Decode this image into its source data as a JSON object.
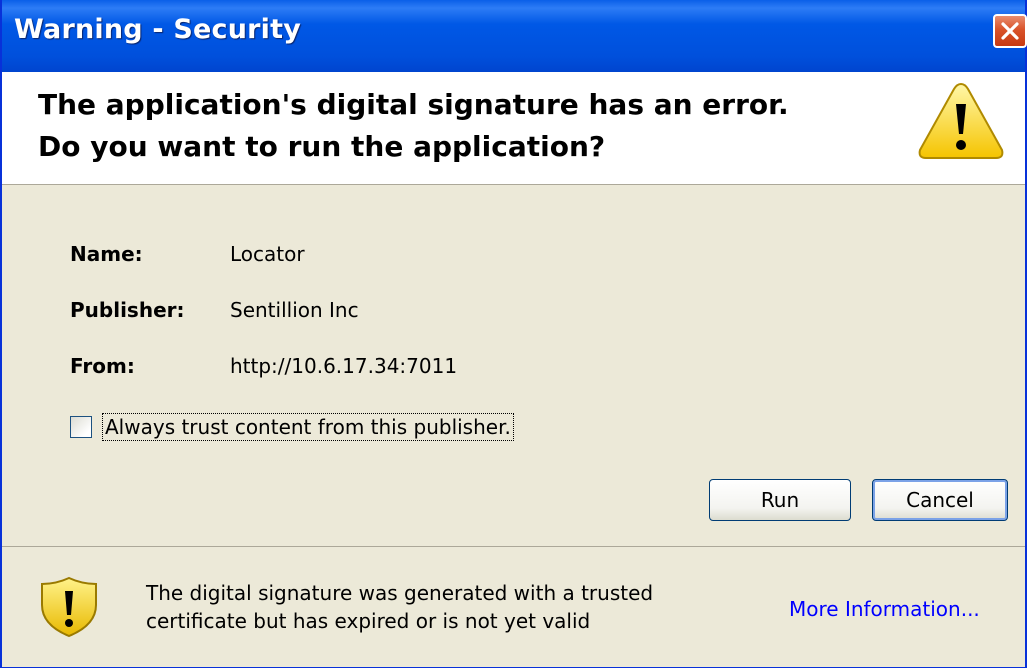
{
  "window": {
    "title": "Warning - Security",
    "close_icon": "close-icon"
  },
  "header": {
    "line1": "The application's digital signature has an error.",
    "line2": "Do you want to run the application?",
    "icon": "warning-triangle-icon"
  },
  "details": {
    "name_label": "Name:",
    "name_value": "Locator",
    "publisher_label": "Publisher:",
    "publisher_value": "Sentillion Inc",
    "from_label": "From:",
    "from_value": "http://10.6.17.34:7011"
  },
  "trust_checkbox": {
    "label": "Always trust content from this publisher.",
    "checked": false
  },
  "buttons": {
    "run": "Run",
    "cancel": "Cancel"
  },
  "footer": {
    "icon": "shield-warning-icon",
    "line1": "The digital signature was generated with a trusted",
    "line2": "certificate but has expired or is not yet valid",
    "link": "More Information..."
  },
  "colors": {
    "titlebar": "#0058e6",
    "dialog_bg": "#ece9d8",
    "link": "#0000ff",
    "close_button": "#d9532a"
  }
}
